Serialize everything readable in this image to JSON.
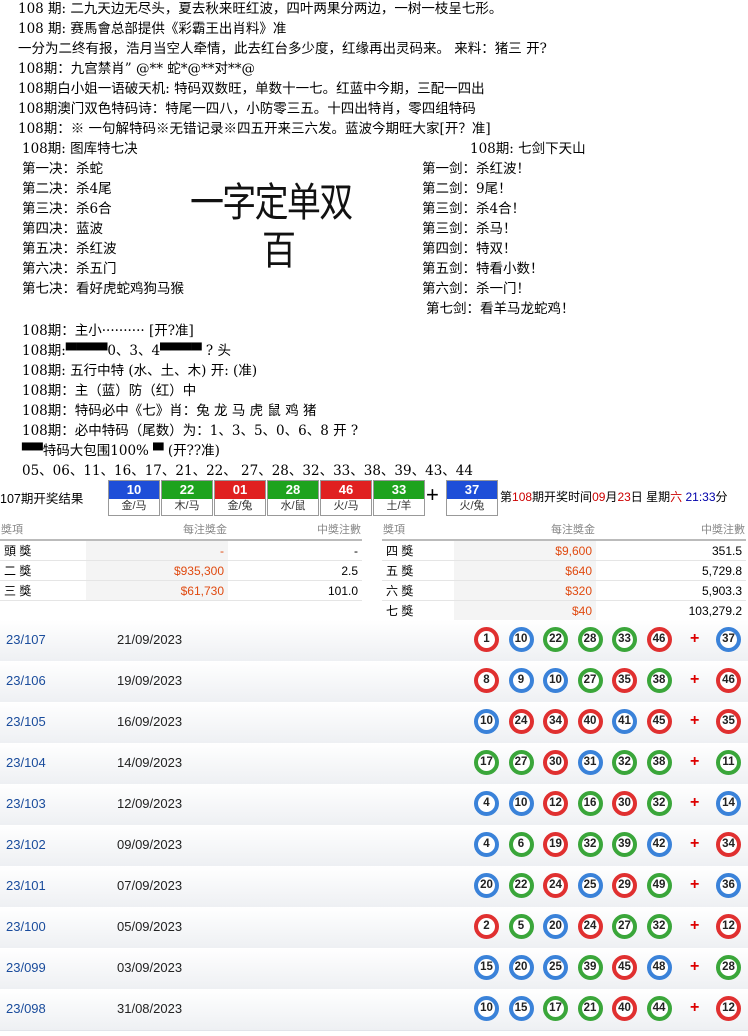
{
  "text_lines": [
    "108 期:   二九天边无尽头，夏去秋来旺红波，四叶两果分两边，一树一枝呈七形。",
    "108 期:   赛馬會总部提供《彩霸王出肖料》准",
    "一分为二终有报，浩月当空人牵情，此去红台多少度，红缘再出灵码来。  来料：猪三    开?",
    "108期：九宫禁肖”  @** 蛇*@**对**@",
    "108期白小姐一语破天机:  特码双数旺，单数十一七。红蓝中今期，三配一四出",
    "108期澳门双色特码诗：特尾一四八，小防零三五。十四出特肖，零四组特码",
    "108期：※  一句解特码※无错记录※四五开来三六发。蓝波今期旺大家[开？准]"
  ],
  "left_title": "108期:                  图库特七决",
  "right_title": "108期:   七剑下天山",
  "left_list": [
    "第一决：杀蛇",
    "第二决：杀4尾",
    "第三决：杀6合",
    "第四决：蓝波",
    "第五决：杀红波",
    "第六决：杀五门",
    "第七决：看好虎蛇鸡狗马猴"
  ],
  "right_list": [
    "第一剑：杀红波！",
    "第二剑：9尾！",
    "第三剑：杀4合！",
    "第三剑：杀马！",
    "第四剑：特双！",
    "第五剑：特看小数！",
    "第六剑：杀一门！",
    "第七剑：看羊马龙蛇鸡！"
  ],
  "big_text": {
    "line1": "一字定单双",
    "line2": "百"
  },
  "lower_lines": [
    "108期：主小·········· [开?准]",
    "108期:▀▀▀▀0、3、4▀▀▀▀  ? 头",
    "108期:   五行中特    (水、土、木) 开: (准)",
    "108期：主（蓝）防（红）中",
    "108期：特码必中《七》肖：兔  龙  马  虎  鼠  鸡    猪",
    "108期：必中特码（尾数）为：1、3、5、0、6、8        开 ?",
    "▀▀特码大包围100%  ▀     (开??准)",
    "05、06、11、16、17、21、22、 27、28、32、33、38、39、43、44"
  ],
  "result": {
    "label": "107期开奖结果",
    "balls": [
      {
        "num": "10",
        "zx": "金/马",
        "color": "#1e4ed8"
      },
      {
        "num": "22",
        "zx": "木/马",
        "color": "#1ea31e"
      },
      {
        "num": "01",
        "zx": "金/兔",
        "color": "#e02020"
      },
      {
        "num": "28",
        "zx": "水/鼠",
        "color": "#1ea31e"
      },
      {
        "num": "46",
        "zx": "火/马",
        "color": "#e02020"
      },
      {
        "num": "33",
        "zx": "土/羊",
        "color": "#1ea31e"
      }
    ],
    "plus": "+",
    "special": {
      "num": "37",
      "zx": "火/兔",
      "color": "#1e4ed8"
    },
    "next_prefix": "第",
    "next_issue": "108",
    "next_mid": "期开奖时间",
    "next_month": "09",
    "next_m": "月",
    "next_day": "23",
    "next_d": "日  星期",
    "next_weekday": "六",
    "next_time": "21:33",
    "next_tail": "分"
  },
  "prize_left": {
    "headers": [
      "獎項",
      "每注獎金",
      "中獎注數"
    ],
    "rows": [
      {
        "name": "頭 獎",
        "amount": "-",
        "winners": "-"
      },
      {
        "name": "二 獎",
        "amount": "$935,300",
        "winners": "2.5"
      },
      {
        "name": "三 獎",
        "amount": "$61,730",
        "winners": "101.0"
      }
    ]
  },
  "prize_right": {
    "headers": [
      "獎項",
      "每注獎金",
      "中獎注數"
    ],
    "rows": [
      {
        "name": "四 獎",
        "amount": "$9,600",
        "winners": "351.5"
      },
      {
        "name": "五 獎",
        "amount": "$640",
        "winners": "5,729.8"
      },
      {
        "name": "六 獎",
        "amount": "$320",
        "winners": "5,903.3"
      },
      {
        "name": "七 獎",
        "amount": "$40",
        "winners": "103,279.2"
      }
    ]
  },
  "history": [
    {
      "draw": "23/107",
      "date": "21/09/2023",
      "nums": [
        "1",
        "10",
        "22",
        "28",
        "33",
        "46"
      ],
      "colors": [
        "red",
        "blue",
        "green",
        "green",
        "green",
        "red"
      ],
      "special": "37",
      "special_color": "blue"
    },
    {
      "draw": "23/106",
      "date": "19/09/2023",
      "nums": [
        "8",
        "9",
        "10",
        "27",
        "35",
        "38"
      ],
      "colors": [
        "red",
        "blue",
        "blue",
        "green",
        "red",
        "green"
      ],
      "special": "46",
      "special_color": "red"
    },
    {
      "draw": "23/105",
      "date": "16/09/2023",
      "nums": [
        "10",
        "24",
        "34",
        "40",
        "41",
        "45"
      ],
      "colors": [
        "blue",
        "red",
        "red",
        "red",
        "blue",
        "red"
      ],
      "special": "35",
      "special_color": "red"
    },
    {
      "draw": "23/104",
      "date": "14/09/2023",
      "nums": [
        "17",
        "27",
        "30",
        "31",
        "32",
        "38"
      ],
      "colors": [
        "green",
        "green",
        "red",
        "blue",
        "green",
        "green"
      ],
      "special": "11",
      "special_color": "green"
    },
    {
      "draw": "23/103",
      "date": "12/09/2023",
      "nums": [
        "4",
        "10",
        "12",
        "16",
        "30",
        "32"
      ],
      "colors": [
        "blue",
        "blue",
        "red",
        "green",
        "red",
        "green"
      ],
      "special": "14",
      "special_color": "blue"
    },
    {
      "draw": "23/102",
      "date": "09/09/2023",
      "nums": [
        "4",
        "6",
        "19",
        "32",
        "39",
        "42"
      ],
      "colors": [
        "blue",
        "green",
        "red",
        "green",
        "green",
        "blue"
      ],
      "special": "34",
      "special_color": "red"
    },
    {
      "draw": "23/101",
      "date": "07/09/2023",
      "nums": [
        "20",
        "22",
        "24",
        "25",
        "29",
        "49"
      ],
      "colors": [
        "blue",
        "green",
        "red",
        "blue",
        "red",
        "green"
      ],
      "special": "36",
      "special_color": "blue"
    },
    {
      "draw": "23/100",
      "date": "05/09/2023",
      "nums": [
        "2",
        "5",
        "20",
        "24",
        "27",
        "32"
      ],
      "colors": [
        "red",
        "green",
        "blue",
        "red",
        "green",
        "green"
      ],
      "special": "12",
      "special_color": "red"
    },
    {
      "draw": "23/099",
      "date": "03/09/2023",
      "nums": [
        "15",
        "20",
        "25",
        "39",
        "45",
        "48"
      ],
      "colors": [
        "blue",
        "blue",
        "blue",
        "green",
        "red",
        "blue"
      ],
      "special": "28",
      "special_color": "green"
    },
    {
      "draw": "23/098",
      "date": "31/08/2023",
      "nums": [
        "10",
        "15",
        "17",
        "21",
        "40",
        "44"
      ],
      "colors": [
        "blue",
        "blue",
        "green",
        "green",
        "red",
        "green"
      ],
      "special": "12",
      "special_color": "red"
    }
  ]
}
